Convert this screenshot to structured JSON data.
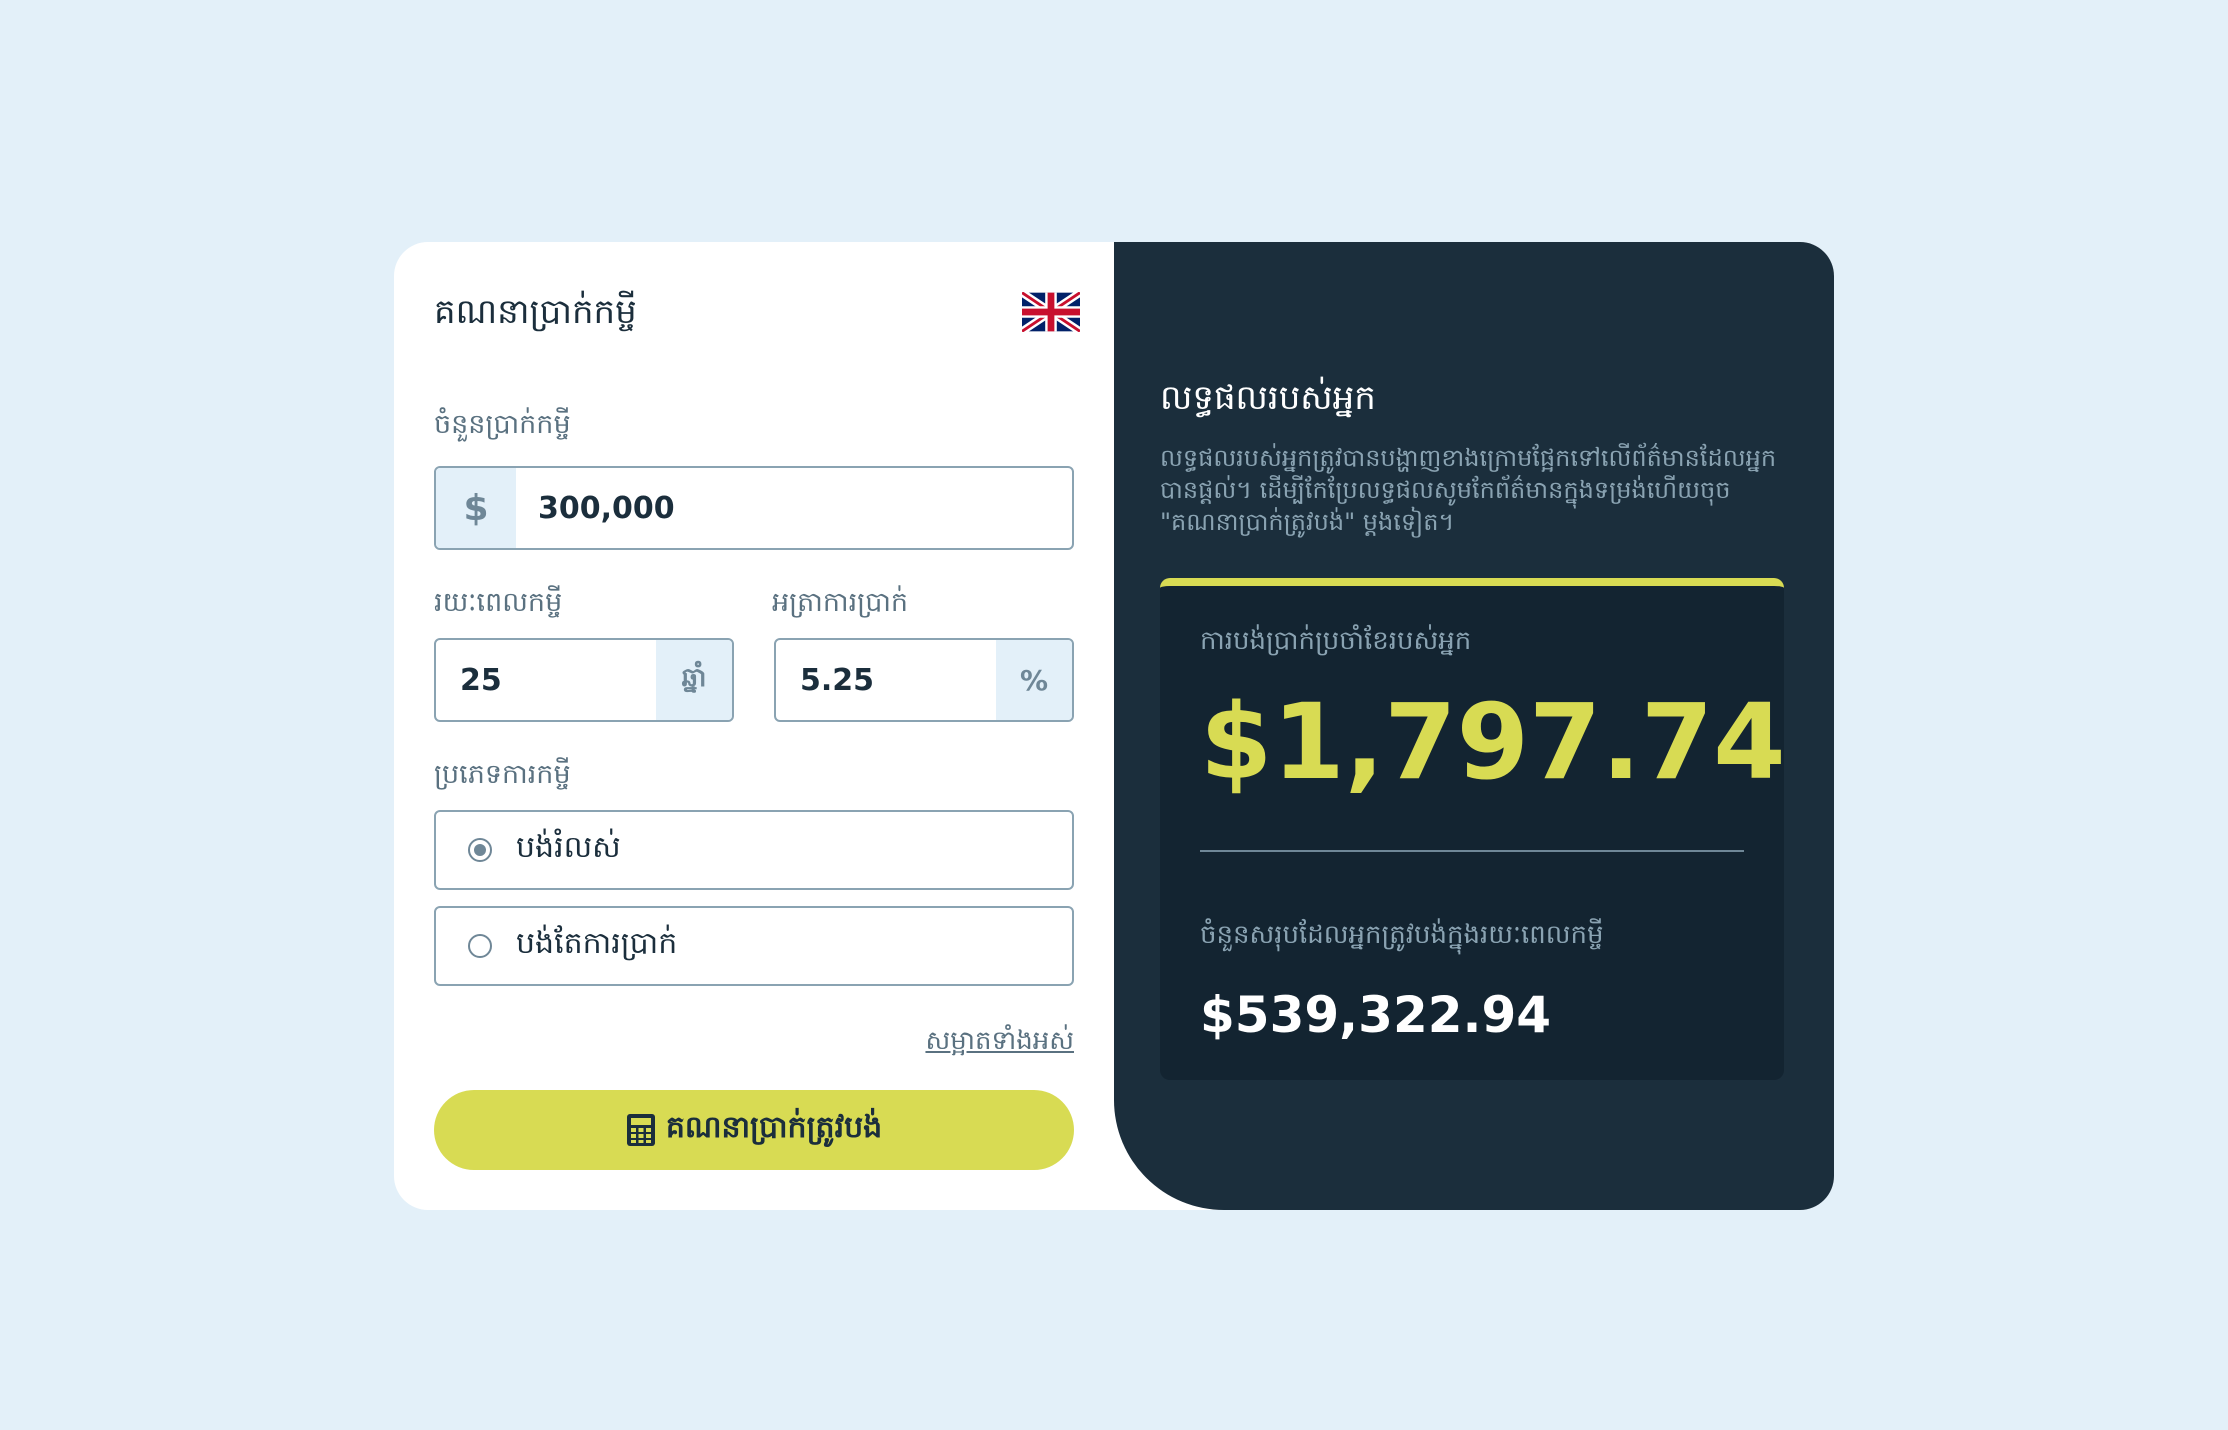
{
  "app": {
    "title": "គណនាប្រាក់កម្ចី",
    "language_flag": "uk-flag-icon"
  },
  "form": {
    "amount": {
      "label": "ចំនួនប្រាក់កម្ចី",
      "prefix": "$",
      "value": "300,000"
    },
    "term": {
      "label": "រយៈពេលកម្ចី",
      "value": "25",
      "suffix": "ឆ្នាំ"
    },
    "rate": {
      "label": "អត្រាការប្រាក់",
      "value": "5.25",
      "suffix": "%"
    },
    "type": {
      "label": "ប្រភេទការកម្ចី",
      "options": [
        {
          "label": "បង់រំលស់",
          "selected": true
        },
        {
          "label": "បង់តែការប្រាក់",
          "selected": false
        }
      ]
    },
    "clear_all": "សម្អាតទាំងអស់",
    "calculate_button": "គណនាប្រាក់ត្រូវបង់"
  },
  "results": {
    "title": "លទ្ធផលរបស់អ្នក",
    "description": "លទ្ធផលរបស់អ្នកត្រូវបានបង្ហាញខាងក្រោមផ្អែកទៅលើព័ត៌មានដែលអ្នកបានផ្តល់។ ដើម្បីកែប្រែលទ្ធផលសូមកែព័ត៌មានក្នុងទម្រង់ហើយចុច \"គណនាប្រាក់ត្រូវបង់\" ម្តងទៀត។",
    "monthly_label": "ការបង់ប្រាក់ប្រចាំខែរបស់អ្នក",
    "monthly_value": "$1,797.74",
    "total_label": "ចំនួនសរុបដែលអ្នកត្រូវបង់ក្នុងរយៈពេលកម្ចី",
    "total_value": "$539,322.94"
  },
  "colors": {
    "background": "#e3f0f9",
    "dark_panel": "#1b2e3c",
    "accent": "#d8db53"
  }
}
